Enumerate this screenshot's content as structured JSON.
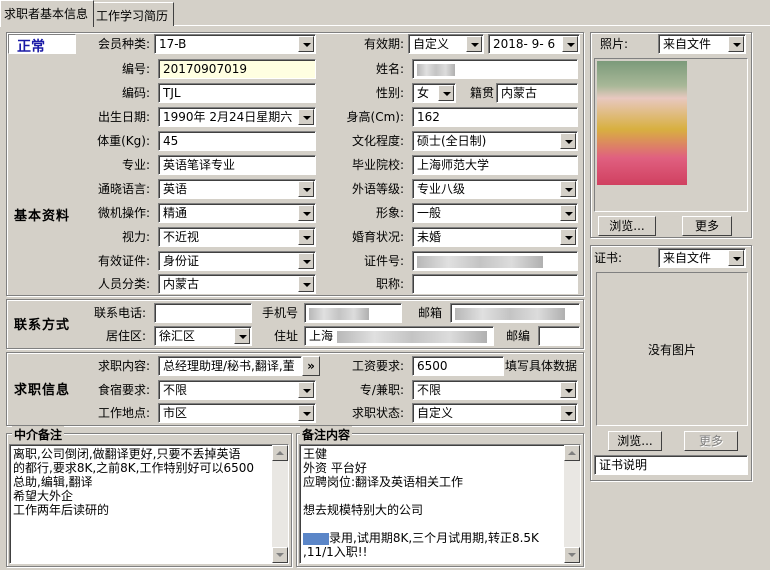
{
  "tabs": [
    "求职者基本信息",
    "工作学习简历"
  ],
  "status_label": "正常",
  "section_titles": {
    "basic": "基本资料",
    "contact": "联系方式",
    "job": "求职信息"
  },
  "fields": {
    "member_type": {
      "label": "会员种类:",
      "value": "17-B"
    },
    "validity": {
      "label": "有效期:",
      "value": "自定义",
      "date": "2018- 9- 6"
    },
    "serial_no": {
      "label": "编号:",
      "value": "20170907019"
    },
    "name": {
      "label": "姓名:",
      "value": ""
    },
    "code": {
      "label": "编码:",
      "value": "TJL"
    },
    "gender": {
      "label": "性别:",
      "value": "女"
    },
    "native_place": {
      "label": "籍贯",
      "value": "内蒙古"
    },
    "birth_date": {
      "label": "出生日期:",
      "value": "1990年 2月24日星期六"
    },
    "height": {
      "label": "身高(Cm):",
      "value": "162"
    },
    "weight": {
      "label": "体重(Kg):",
      "value": "45"
    },
    "education": {
      "label": "文化程度:",
      "value": "硕士(全日制)"
    },
    "major": {
      "label": "专业:",
      "value": "英语笔译专业"
    },
    "school": {
      "label": "毕业院校:",
      "value": "上海师范大学"
    },
    "language": {
      "label": "通晓语言:",
      "value": "英语"
    },
    "foreign_level": {
      "label": "外语等级:",
      "value": "专业八级"
    },
    "computer": {
      "label": "微机操作:",
      "value": "精通"
    },
    "image": {
      "label": "形象:",
      "value": "一般"
    },
    "vision": {
      "label": "视力:",
      "value": "不近视"
    },
    "marital": {
      "label": "婚育状况:",
      "value": "未婚"
    },
    "id_type": {
      "label": "有效证件:",
      "value": "身份证"
    },
    "id_no": {
      "label": "证件号:",
      "value": ""
    },
    "category": {
      "label": "人员分类:",
      "value": "内蒙古"
    },
    "title": {
      "label": "职称:",
      "value": ""
    },
    "phone": {
      "label": "联系电话:",
      "value": ""
    },
    "mobile": {
      "label": "手机号",
      "value": ""
    },
    "email": {
      "label": "邮箱",
      "value": ""
    },
    "district": {
      "label": "居住区:",
      "value": "徐汇区"
    },
    "address": {
      "label": "住址",
      "value": "上海"
    },
    "postcode": {
      "label": "邮编",
      "value": ""
    },
    "job_wanted": {
      "label": "求职内容:",
      "value": "总经理助理/秘书,翻译,董"
    },
    "salary": {
      "label": "工资要求:",
      "value": "6500",
      "hint": "填写具体数据"
    },
    "lodging": {
      "label": "食宿要求:",
      "value": "不限"
    },
    "job_type": {
      "label": "专/兼职:",
      "value": "不限"
    },
    "work_place": {
      "label": "工作地点:",
      "value": "市区"
    },
    "job_status": {
      "label": "求职状态:",
      "value": "自定义"
    }
  },
  "expand_button": "»",
  "photo": {
    "label": "照片:",
    "source": "来自文件",
    "browse": "浏览...",
    "more": "更多"
  },
  "certificate": {
    "label": "证书:",
    "source": "来自文件",
    "empty": "没有图片",
    "browse": "浏览...",
    "more": "更多",
    "desc_value": "证书说明"
  },
  "agent_notes": {
    "title": "中介备注",
    "lines": [
      "离职,公司倒闭,做翻译更好,只要不丢掉英语",
      "的都行,要求8K,之前8K,工作特别好可以6500",
      "总助,编辑,翻译",
      "希望大外企",
      "工作两年后读研的"
    ]
  },
  "remarks": {
    "title": "备注内容",
    "lines": [
      "王健",
      "外资 平台好",
      "应聘岗位:翻译及英语相关工作",
      "",
      "想去规模特别大的公司",
      "",
      "录用,试用期8K,三个月试用期,转正8.5K",
      ",11/1入职!!"
    ]
  },
  "colors": {
    "status": "#1a1aa6",
    "background": "#d4d0c8",
    "highlight_input": "#ffffe1"
  }
}
